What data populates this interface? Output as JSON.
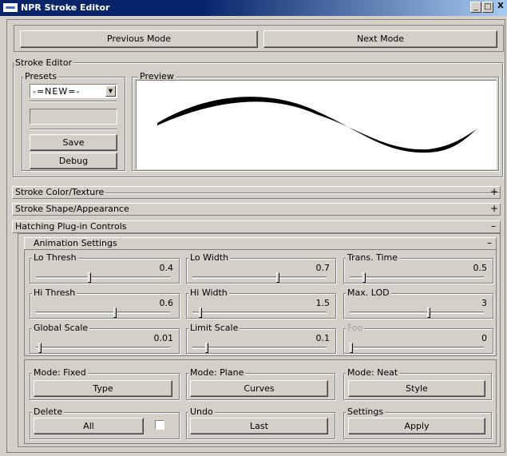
{
  "window": {
    "title": "NPR Stroke Editor",
    "buttons": [
      "_",
      "□",
      "X"
    ]
  },
  "mode_buttons": {
    "previous": "Previous Mode",
    "next": "Next Mode"
  },
  "stroke_editor": {
    "label": "Stroke Editor",
    "presets": {
      "label": "Presets",
      "selected": "-=NEW=-",
      "text_value": "",
      "save": "Save",
      "debug": "Debug"
    },
    "preview": {
      "label": "Preview"
    }
  },
  "rollups": {
    "color_texture": {
      "label": "Stroke Color/Texture",
      "toggle": "+"
    },
    "shape_appearance": {
      "label": "Stroke Shape/Appearance",
      "toggle": "+"
    },
    "hatching": {
      "label": "Hatching Plug-in Controls",
      "toggle": "–"
    }
  },
  "animation": {
    "label": "Animation Settings",
    "toggle": "–",
    "sliders": [
      {
        "label": "Lo Thresh",
        "value": "0.4",
        "enabled": true,
        "fraction": 0.4
      },
      {
        "label": "Lo Width",
        "value": "0.7",
        "enabled": true,
        "fraction": 0.65
      },
      {
        "label": "Trans. Time",
        "value": "0.5",
        "enabled": true,
        "fraction": 0.1
      },
      {
        "label": "Hi Thresh",
        "value": "0.6",
        "enabled": true,
        "fraction": 0.6
      },
      {
        "label": "Hi Width",
        "value": "1.5",
        "enabled": true,
        "fraction": 0.05
      },
      {
        "label": "Max. LOD",
        "value": "3",
        "enabled": true,
        "fraction": 0.6
      },
      {
        "label": "Global Scale",
        "value": "0.01",
        "enabled": true,
        "fraction": 0.02
      },
      {
        "label": "Limit Scale",
        "value": "0.1",
        "enabled": true,
        "fraction": 0.1
      },
      {
        "label": "Foo",
        "value": "0",
        "enabled": false,
        "fraction": 0.0
      }
    ]
  },
  "modes": {
    "fixed": {
      "label": "Mode: Fixed",
      "button": "Type"
    },
    "plane": {
      "label": "Mode: Plane",
      "button": "Curves"
    },
    "neat": {
      "label": "Mode: Neat",
      "button": "Style"
    },
    "delete": {
      "label": "Delete",
      "button": "All",
      "checked": false
    },
    "undo": {
      "label": "Undo",
      "button": "Last"
    },
    "settings": {
      "label": "Settings",
      "button": "Apply"
    }
  }
}
